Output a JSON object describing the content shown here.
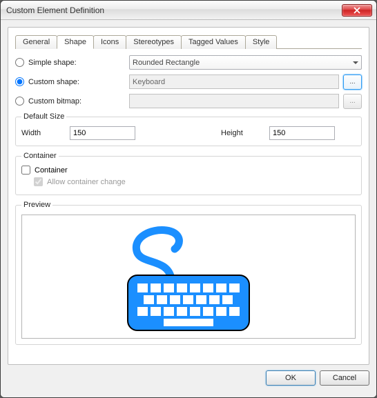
{
  "window": {
    "title": "Custom Element Definition"
  },
  "tabs": {
    "general": "General",
    "shape": "Shape",
    "icons": "Icons",
    "stereotypes": "Stereotypes",
    "tagged_values": "Tagged Values",
    "style": "Style"
  },
  "shape_opts": {
    "simple_label": "Simple shape:",
    "simple_value": "Rounded Rectangle",
    "custom_label": "Custom shape:",
    "custom_value": "Keyboard",
    "bitmap_label": "Custom bitmap:",
    "bitmap_value": "",
    "browse_label": "..."
  },
  "default_size": {
    "legend": "Default Size",
    "width_label": "Width",
    "width_value": "150",
    "height_label": "Height",
    "height_value": "150"
  },
  "container": {
    "legend": "Container",
    "container_label": "Container",
    "allow_change_label": "Allow container change"
  },
  "preview": {
    "legend": "Preview"
  },
  "buttons": {
    "ok": "OK",
    "cancel": "Cancel"
  },
  "colors": {
    "keyboard_blue": "#1b8fff"
  }
}
